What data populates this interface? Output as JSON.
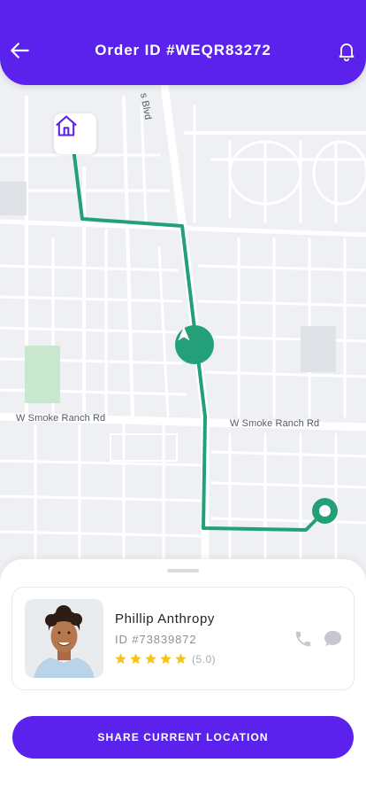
{
  "header": {
    "title": "Order ID #WEQR83272",
    "back_icon": "arrow-left-icon",
    "bell_icon": "bell-icon"
  },
  "map": {
    "road_labels": {
      "smoke_ranch_west": "W Smoke Ranch Rd",
      "smoke_ranch_east": "W Smoke Ranch Rd",
      "blvd": "s Blvd"
    },
    "home_icon": "home-icon",
    "navigation_icon": "navigation-arrow-icon",
    "destination_icon": "destination-pin-icon",
    "route_color": "#23a077"
  },
  "driver": {
    "name": "Phillip Anthropy",
    "id": "ID #73839872",
    "rating": 5.0,
    "rating_label": "(5.0)",
    "stars": 5,
    "call_icon": "phone-icon",
    "chat_icon": "chat-bubble-icon"
  },
  "actions": {
    "share_label": "SHARE CURRENT LOCATION"
  },
  "colors": {
    "brand": "#5b22ee",
    "route": "#23a077",
    "star": "#f5c518",
    "map_bg": "#eef0f3",
    "map_road": "#ffffff",
    "park": "#c9e6cf"
  }
}
